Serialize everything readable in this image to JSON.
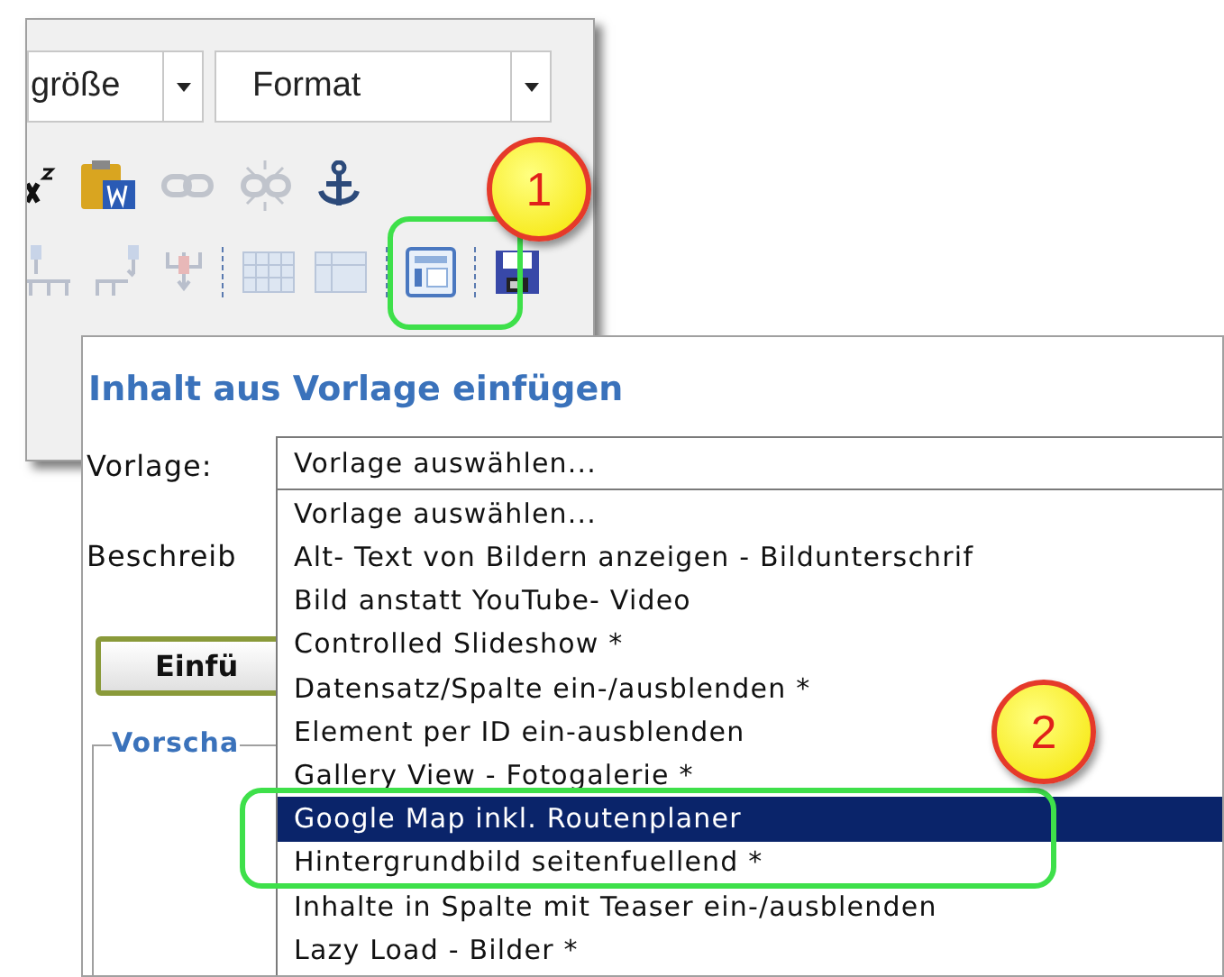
{
  "editor": {
    "font_size_combo": "größe",
    "format_combo": "Format"
  },
  "callouts": [
    {
      "number": "1"
    },
    {
      "number": "2"
    }
  ],
  "dialog": {
    "title": "Inhalt aus Vorlage einfügen",
    "template_label": "Vorlage:",
    "template_value": "Vorlage auswählen...",
    "description_label": "Beschreib",
    "insert_button": "Einfü",
    "preview_legend": "Vorscha",
    "options": [
      {
        "label": "Vorlage auswählen...",
        "selected": false
      },
      {
        "label": "Alt- Text von Bildern anzeigen - Bildunterschrif",
        "selected": false
      },
      {
        "label": "Bild anstatt YouTube- Video",
        "selected": false
      },
      {
        "label": "Controlled Slideshow *",
        "selected": false
      },
      {
        "label": "Datensatz/Spalte ein-/ausblenden *",
        "selected": false
      },
      {
        "label": "Element per ID ein-ausblenden",
        "selected": false
      },
      {
        "label": "Gallery View - Fotogalerie *",
        "selected": false
      },
      {
        "label": "Google Map inkl. Routenplaner",
        "selected": true
      },
      {
        "label": "Hintergrundbild seitenfuellend *",
        "selected": false
      },
      {
        "label": "Inhalte in Spalte mit Teaser ein-/ausblenden",
        "selected": false
      },
      {
        "label": "Lazy Load - Bilder *",
        "selected": false
      }
    ]
  }
}
